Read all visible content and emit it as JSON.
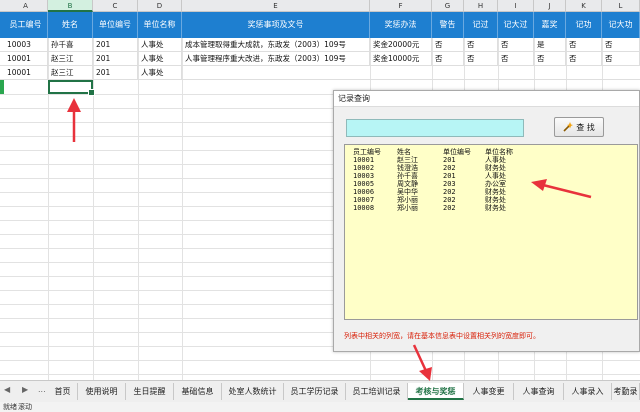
{
  "column_letters": [
    "A",
    "B",
    "C",
    "D",
    "E",
    "F",
    "G",
    "H",
    "I",
    "J",
    "K",
    "L"
  ],
  "active_column": "B",
  "table": {
    "headers": [
      "员工编号",
      "姓名",
      "单位编号",
      "单位名称",
      "奖惩事项及文号",
      "奖惩办法",
      "警告",
      "记过",
      "记大过",
      "嘉奖",
      "记功",
      "记大功"
    ],
    "rows": [
      [
        "10003",
        "孙千喜",
        "201",
        "人事处",
        "成本管理取得重大成就，东政发（2003）109号",
        "奖金20000元",
        "否",
        "否",
        "否",
        "是",
        "否",
        "否"
      ],
      [
        "10001",
        "赵三江",
        "201",
        "人事处",
        "人事管理程序重大改进，东政发（2003）109号",
        "奖金10000元",
        "否",
        "否",
        "否",
        "否",
        "否",
        "否"
      ],
      [
        "10001",
        "赵三江",
        "201",
        "人事处",
        "",
        "",
        "",
        "",
        "",
        "",
        "",
        ""
      ]
    ]
  },
  "dialog": {
    "title": "记录查询",
    "search_value": "",
    "search_button_label": "查 找",
    "list_columns": [
      "员工编号",
      "姓名",
      "单位编号",
      "单位名称"
    ],
    "list_rows": [
      [
        "10001",
        "赵三江",
        "201",
        "人事处"
      ],
      [
        "10002",
        "钱澄浩",
        "202",
        "财务处"
      ],
      [
        "10003",
        "孙千喜",
        "201",
        "人事处"
      ],
      [
        "10005",
        "周文静",
        "203",
        "办公室"
      ],
      [
        "10006",
        "吴中华",
        "202",
        "财务处"
      ],
      [
        "10007",
        "郑小丽",
        "202",
        "财务处"
      ],
      [
        "10008",
        "郑小丽",
        "202",
        "财务处"
      ]
    ],
    "hint": "列表中相关的列宽，请在基本信息表中设置相关列的宽度即可。"
  },
  "tabs": {
    "items": [
      "首页",
      "使用说明",
      "生日提醒",
      "基础信息",
      "处室人数统计",
      "员工学历记录",
      "员工培训记录",
      "考核与奖惩",
      "人事变更",
      "人事查询",
      "人事录入",
      "考勤录"
    ],
    "active": "考核与奖惩"
  },
  "nav": {
    "prev": "◀",
    "next": "▶",
    "more": "..."
  },
  "status": {
    "mode": "就绪",
    "scroll": "滚动"
  },
  "colors": {
    "header_bg": "#1e7fd0",
    "dialog_input": "#b7f5f5",
    "list_bg": "#ffffc8",
    "hint": "#d81e06",
    "arrow": "#e8323c",
    "accent": "#217346"
  }
}
